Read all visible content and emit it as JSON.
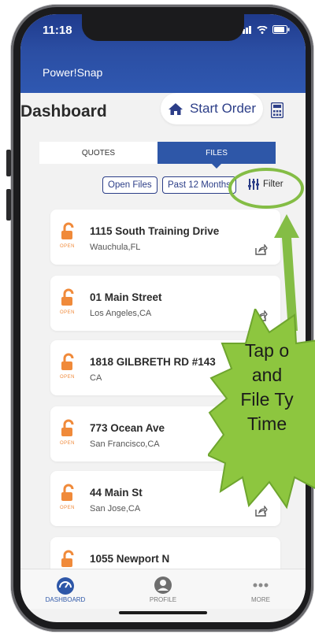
{
  "status_bar": {
    "time": "11:18"
  },
  "app": {
    "name": "Power!Snap"
  },
  "dashboard": {
    "title": "Dashboard",
    "start_order_label": "Start Order"
  },
  "tabs": [
    {
      "label": "QUOTES",
      "active": false
    },
    {
      "label": "FILES",
      "active": true
    }
  ],
  "filters": {
    "status_chip": "Open Files",
    "period_chip": "Past 12 Months",
    "filter_label": "Filter"
  },
  "files": [
    {
      "status": "OPEN",
      "address": "1115 South Training Drive",
      "city": "Wauchula,FL"
    },
    {
      "status": "OPEN",
      "address": "01 Main Street",
      "city": "Los Angeles,CA"
    },
    {
      "status": "OPEN",
      "address": "1818 GILBRETH RD #143",
      "city": "CA"
    },
    {
      "status": "OPEN",
      "address": "773 Ocean Ave",
      "city": "San Francisco,CA"
    },
    {
      "status": "OPEN",
      "address": "44 Main St",
      "city": "San Jose,CA"
    },
    {
      "status": "OPEN",
      "address": "1055 Newport N",
      "city": ""
    }
  ],
  "callout": {
    "lines": [
      "Tap o",
      "and",
      "File Ty",
      "Time"
    ],
    "color": "#8dc63f"
  },
  "bottom_nav": [
    {
      "label": "DASHBOARD",
      "icon": "dashboard-icon",
      "active": true
    },
    {
      "label": "PROFILE",
      "icon": "profile-icon",
      "active": false
    },
    {
      "label": "MORE",
      "icon": "more-icon",
      "active": false
    }
  ],
  "colors": {
    "brand_blue": "#2b4ea3",
    "lock_orange": "#f08a3a",
    "highlight_green": "#84bd45"
  }
}
